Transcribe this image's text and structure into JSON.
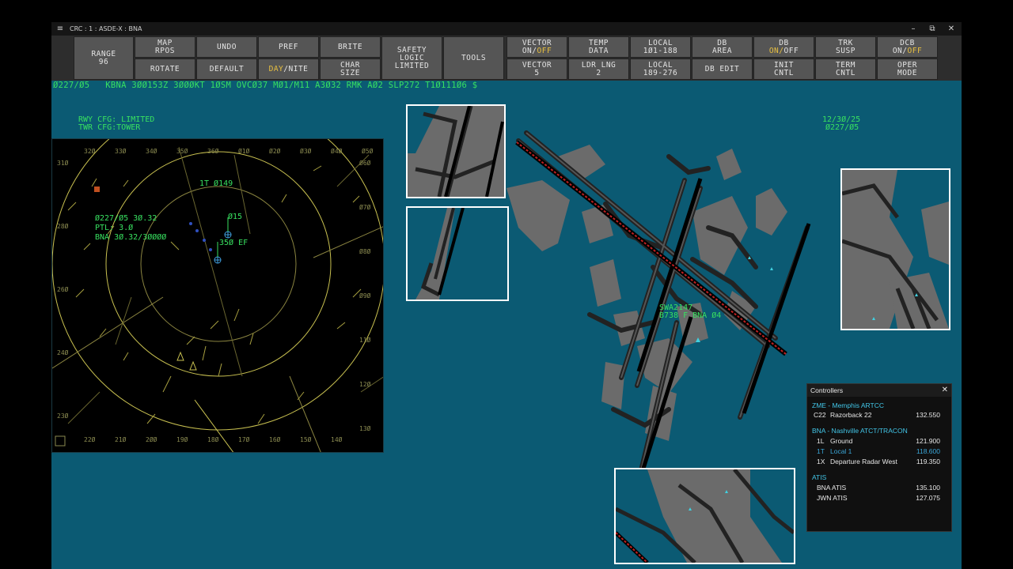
{
  "window": {
    "title": "CRC : 1 : ASDE-X : BNA",
    "menu_glyph": "≡",
    "minimize": "–",
    "restore": "⧉",
    "close": "✕"
  },
  "toolbar": {
    "range": {
      "l1": "RANGE",
      "l2": "96"
    },
    "map_rpos": {
      "l1": "MAP",
      "l2": "RPOS"
    },
    "rotate": "ROTATE",
    "undo": "UNDO",
    "default": "DEFAULT",
    "pref": "PREF",
    "day": "DAY",
    "nite": "/NITE",
    "brite": "BRITE",
    "char_size": {
      "l1": "CHAR",
      "l2": "SIZE"
    },
    "safety_logic": {
      "l1": "SAFETY",
      "l2": "LOGIC",
      "l3": "LIMITED"
    },
    "tools": "TOOLS",
    "vector_onoff": {
      "l1": "VECTOR",
      "on": "ON/",
      "off": "OFF"
    },
    "vector_5": {
      "l1": "VECTOR",
      "l2": "5"
    },
    "temp_data": {
      "l1": "TEMP",
      "l2": "DATA"
    },
    "ldr_lng": {
      "l1": "LDR LNG",
      "l2": "2"
    },
    "local_101": {
      "l1": "LOCAL",
      "l2": "1Ø1-188"
    },
    "local_189": {
      "l1": "LOCAL",
      "l2": "189-276"
    },
    "db_area": {
      "l1": "DB",
      "l2": "AREA"
    },
    "db_edit": "DB EDIT",
    "db_onoff": {
      "l1": "DB",
      "on": "ON/",
      "off": "OFF"
    },
    "init_cntl": {
      "l1": "INIT",
      "l2": "CNTL"
    },
    "trk_susp": {
      "l1": "TRK",
      "l2": "SUSP"
    },
    "term_cntl": {
      "l1": "TERM",
      "l2": "CNTL"
    },
    "dcb_onoff": {
      "l1": "DCB",
      "on": "ON/",
      "off": "OFF"
    },
    "oper_mode": {
      "l1": "OPER",
      "l2": "MODE"
    }
  },
  "metar": "Ø227/Ø5   KBNA 3ØØ153Z 3ØØØKT 1ØSM OVCØ37 MØ1/M11 A3Ø32 RMK AØ2 SLP272 T1Ø111Ø6 $",
  "runway_config": {
    "rwy": "RWY CFG: LIMITED",
    "twr": "TWR CFG:TOWER"
  },
  "date_time": {
    "date": "12/3Ø/25",
    "time": "Ø227/Ø5"
  },
  "radar": {
    "top_ticks": [
      "32Ø",
      "33Ø",
      "34Ø",
      "35Ø",
      "36Ø",
      "Ø1Ø",
      "Ø2Ø",
      "Ø3Ø",
      "Ø4Ø",
      "Ø5Ø"
    ],
    "bottom_ticks": [
      "22Ø",
      "21Ø",
      "2ØØ",
      "19Ø",
      "18Ø",
      "17Ø",
      "16Ø",
      "15Ø",
      "14Ø"
    ],
    "left_ticks": [
      "31Ø",
      "28Ø",
      "26Ø",
      "24Ø",
      "23Ø"
    ],
    "right_ticks": [
      "Ø6Ø",
      "Ø7Ø",
      "Ø8Ø",
      "Ø9Ø",
      "11Ø",
      "12Ø",
      "13Ø"
    ],
    "info": {
      "line1": "Ø227/Ø5 3Ø.32",
      "line2": "PTL: 3.Ø",
      "line3": "BNA 3Ø.32/3ØØØØ"
    },
    "tag_1t": "1T Ø149",
    "tag_015": "Ø15",
    "tag_350": "35Ø EF"
  },
  "aircraft": {
    "callsign": "SWA2147",
    "info": "B738 F BNA Ø4"
  },
  "controllers": {
    "title": "Controllers",
    "close": "✕",
    "zme_group": "ZME - Memphis ARTCC",
    "zme_rows": [
      {
        "pos": "C22",
        "name": "Razorback 22",
        "freq": "132.550"
      }
    ],
    "bna_group": "BNA - Nashville ATCT/TRACON",
    "bna_rows": [
      {
        "pos": "1L",
        "name": "Ground",
        "freq": "121.900"
      },
      {
        "pos": "1T",
        "name": "Local 1",
        "freq": "118.600"
      },
      {
        "pos": "1X",
        "name": "Departure Radar West",
        "freq": "119.350"
      }
    ],
    "atis_group": "ATIS",
    "atis_rows": [
      {
        "name": "BNA ATIS",
        "freq": "135.100"
      },
      {
        "name": "JWN ATIS",
        "freq": "127.075"
      }
    ]
  },
  "colors": {
    "background": "#0b5a73",
    "text_green": "#38e060",
    "radar_yellow": "#c8c050",
    "accent_cyan": "#42c6e8"
  }
}
